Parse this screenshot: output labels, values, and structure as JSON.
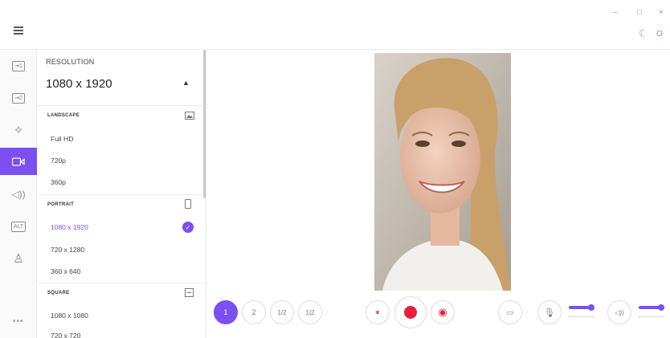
{
  "window": {
    "minimize_glyph": "–",
    "maximize_glyph": "□",
    "close_glyph": "×",
    "moon_glyph": "☾",
    "sun_glyph": "☼"
  },
  "rail": {
    "items": [
      {
        "name": "source-1",
        "glyph": "⇥1"
      },
      {
        "name": "source-2",
        "glyph": "⇥2"
      },
      {
        "name": "effects",
        "glyph": "✧"
      },
      {
        "name": "camera",
        "glyph": "▭◁"
      },
      {
        "name": "audio",
        "glyph": "◁))"
      },
      {
        "name": "alt",
        "glyph": "ALT"
      },
      {
        "name": "account",
        "glyph": "♙"
      }
    ],
    "more_glyph": "•••"
  },
  "resolution": {
    "label": "RESOLUTION",
    "value": "1080 x 1920",
    "caret": "▲",
    "groups": [
      {
        "label": "LANDSCAPE",
        "icon": "landscape-icon",
        "options": [
          "Full HD",
          "720p",
          "360p"
        ]
      },
      {
        "label": "PORTRAIT",
        "icon": "portrait-icon",
        "options": [
          "1080 x 1920",
          "720 x 1280",
          "360 x 640"
        ],
        "selected": 0
      },
      {
        "label": "SQUARE",
        "icon": "square-icon",
        "options": [
          "1080 x 1080",
          "720 x 720"
        ]
      }
    ],
    "check_glyph": "✓"
  },
  "toolbar": {
    "layouts": [
      "1",
      "2",
      "1/2",
      "1|2"
    ],
    "pause_glyph": "⏸",
    "snapshot_glyph": "◉",
    "folder_glyph": "▭",
    "mic_glyph": "🎙",
    "speaker_glyph": "◁))"
  },
  "colors": {
    "accent": "#7b4ff0",
    "record": "#e4203a"
  }
}
